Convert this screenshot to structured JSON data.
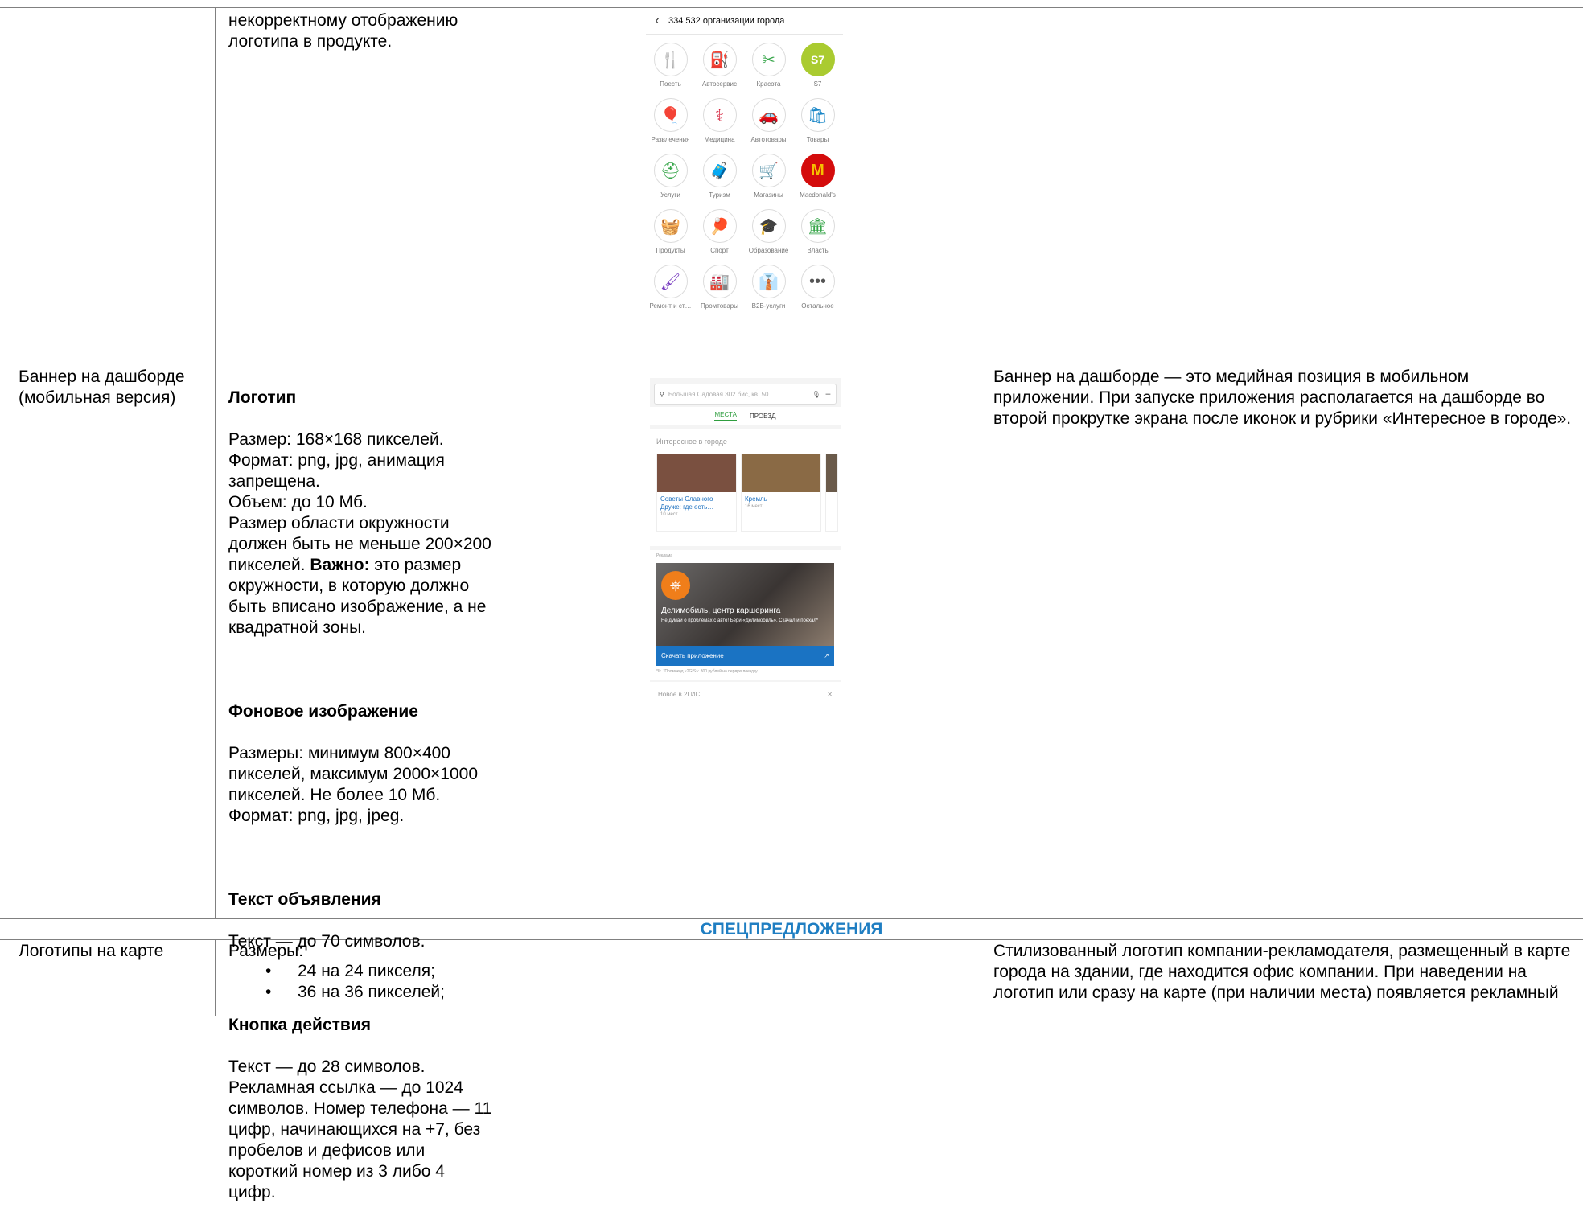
{
  "row1": {
    "col2_text": "некорректному отображению\nлоготипа в продукте.",
    "phone": {
      "header": "334 532 организации города",
      "back_icon": "chevron-left-icon",
      "rubrics": [
        {
          "label": "Поесть",
          "icon": "🍴",
          "color": "#f08a1c"
        },
        {
          "label": "Автосервис",
          "icon": "⛽",
          "color": "#1a87c8"
        },
        {
          "label": "Красота",
          "icon": "✂",
          "color": "#37a64a"
        },
        {
          "label": "S7",
          "icon": "S7",
          "color": "#aacb30"
        },
        {
          "label": "Развлечения",
          "icon": "🎈",
          "color": "#f08a1c"
        },
        {
          "label": "Медицина",
          "icon": "⚕",
          "color": "#d6263f"
        },
        {
          "label": "Автотовары",
          "icon": "🚗",
          "color": "#1a87c8"
        },
        {
          "label": "Товары",
          "icon": "🛍",
          "color": "#1a87c8"
        },
        {
          "label": "Услуги",
          "icon": "⛑",
          "color": "#37a64a"
        },
        {
          "label": "Туризм",
          "icon": "🧳",
          "color": "#f08a1c"
        },
        {
          "label": "Магазины",
          "icon": "🛒",
          "color": "#7a3fc1"
        },
        {
          "label": "Macdonald's",
          "icon": "M",
          "color": "#d40c0c"
        },
        {
          "label": "Продукты",
          "icon": "🧺",
          "color": "#7a3fc1"
        },
        {
          "label": "Спорт",
          "icon": "🏓",
          "color": "#d6263f"
        },
        {
          "label": "Образование",
          "icon": "🎓",
          "color": "#37a64a"
        },
        {
          "label": "Власть",
          "icon": "🏛",
          "color": "#37a64a"
        },
        {
          "label": "Ремонт и ст…",
          "icon": "🖌",
          "color": "#7a3fc1"
        },
        {
          "label": "Промтовары",
          "icon": "🏭",
          "color": "#7a3fc1"
        },
        {
          "label": "B2B-услуги",
          "icon": "👔",
          "color": "#37a64a"
        },
        {
          "label": "Остальное",
          "icon": "•••",
          "color": "#555555"
        }
      ]
    }
  },
  "row2": {
    "col1": "Баннер на дашборде\n(мобильная версия)",
    "col2": {
      "logo_title": "Логотип",
      "logo_text_a": "Размер: 168×168 пикселей.\nФормат: png, jpg, анимация\nзапрещена.\nОбъем: до 10 Мб.\nРазмер области окружности\nдолжен быть не меньше 200×200\nпикселей. ",
      "important": "Важно:",
      "logo_text_b": " это размер\nокружности, в которую должно\nбыть вписано изображение, а не\nквадратной зоны.",
      "bg_title": "Фоновое изображение",
      "bg_text": "Размеры: минимум 800×400\nпикселей, максимум 2000×1000\nпикселей. Не более 10 Мб.\nФормат: png, jpg, jpeg.",
      "ad_title": "Текст объявления",
      "ad_text": "Текст — до 70 символов.",
      "btn_title": "Кнопка действия",
      "btn_text": "Текст — до 28 символов.\nРекламная ссылка — до 1024\nсимволов. Номер телефона — 11\nцифр, начинающихся на +7, без\nпробелов и дефисов или\nкороткий номер из 3 либо 4\nцифр."
    },
    "phone": {
      "search_placeholder": "Большая Садовая 302 бис, кв. 50",
      "tab_places": "МЕСТА",
      "tab_route": "ПРОЕЗД",
      "section_title": "Интересное в городе",
      "cards": [
        {
          "title": "Советы Славного Друже: где есть…",
          "meta": "10 мест",
          "color": "#7a5040"
        },
        {
          "title": "Кремль",
          "meta": "16 мест",
          "color": "#8a6a45"
        }
      ],
      "ad_label": "Реклама",
      "ad_title": "Делимобиль, центр каршеринга",
      "ad_text": "Не думай о проблемах с авто! Бери «Делимобиль». Скачал и поехал*",
      "ad_button": "Скачать приложение",
      "ad_note": "*Ik. \"Промокод «2GIS»: 300 рублей на первую поездку.",
      "new_label": "Новое в 2ГИС"
    },
    "col4": "Баннер на дашборде — это медийная позиция в мобильном\nприложении. При запуске приложения располагается на дашборде во\nвторой прокрутке экрана после иконок и рубрики «Интересное в городе»."
  },
  "section_header": "СПЕЦПРЕДЛОЖЕНИЯ",
  "row3": {
    "col1": "Логотипы на карте",
    "col2_title": "Размеры:",
    "sizes": [
      "24 на 24 пикселя;",
      "36 на 36 пикселей;"
    ],
    "col4": "Стилизованный логотип компании-рекламодателя, размещенный в карте\nгорода на здании, где находится офис компании. При наведении на\nлоготип или сразу на карте (при наличии места) появляется рекламный"
  },
  "colors": {
    "grid": "#808080",
    "section": "#1f7ec2",
    "accent_green": "#2f9e3f"
  }
}
